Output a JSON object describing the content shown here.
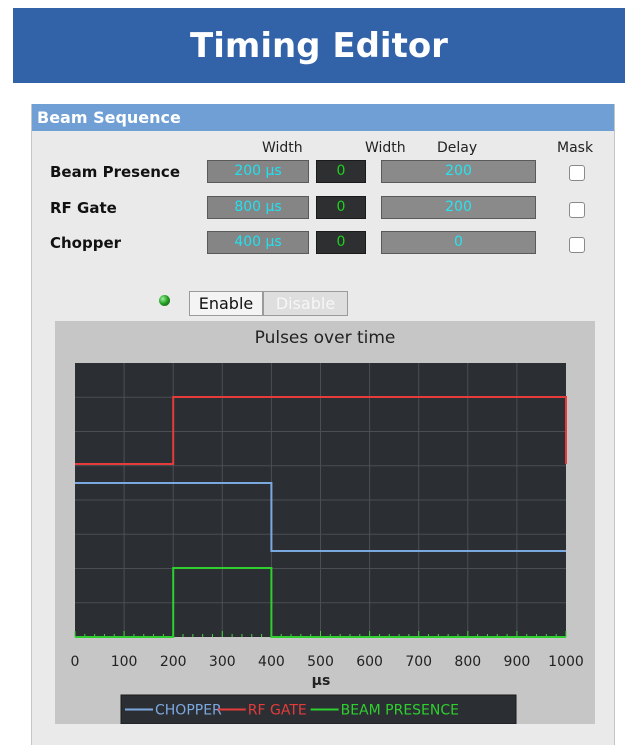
{
  "app": {
    "title": "Timing Editor"
  },
  "panel": {
    "title": "Beam Sequence"
  },
  "columns": {
    "width1": "Width",
    "width2": "Width",
    "delay": "Delay",
    "mask": "Mask"
  },
  "rows": [
    {
      "label": "Beam Presence",
      "width": "200 µs",
      "count": "0",
      "delay": "200",
      "mask": false
    },
    {
      "label": "RF Gate",
      "width": "800 µs",
      "count": "0",
      "delay": "200",
      "mask": false
    },
    {
      "label": "Chopper",
      "width": "400 µs",
      "count": "0",
      "delay": "0",
      "mask": false
    }
  ],
  "controls": {
    "enable": "Enable",
    "disable": "Disable",
    "led_state": "on"
  },
  "chart_data": {
    "type": "line",
    "title": "Pulses over time",
    "xlabel": "µs",
    "xlim": [
      0,
      1000
    ],
    "x_ticks": [
      "0",
      "100",
      "200",
      "300",
      "400",
      "500",
      "600",
      "700",
      "800",
      "900",
      "1000"
    ],
    "grid": true,
    "legend_placement": "bottom",
    "series": [
      {
        "name": "CHOPPER",
        "color": "#7ca8e0",
        "points": [
          [
            0,
            1
          ],
          [
            400,
            1
          ],
          [
            400,
            0
          ],
          [
            1000,
            0
          ]
        ]
      },
      {
        "name": "RF GATE",
        "color": "#e53b3b",
        "points": [
          [
            0,
            0
          ],
          [
            200,
            0
          ],
          [
            200,
            1
          ],
          [
            1000,
            1
          ],
          [
            1000,
            0
          ]
        ]
      },
      {
        "name": "BEAM PRESENCE",
        "color": "#2ecf2e",
        "points": [
          [
            0,
            0
          ],
          [
            200,
            0
          ],
          [
            200,
            1
          ],
          [
            400,
            1
          ],
          [
            400,
            0
          ],
          [
            1000,
            0
          ]
        ]
      }
    ]
  }
}
